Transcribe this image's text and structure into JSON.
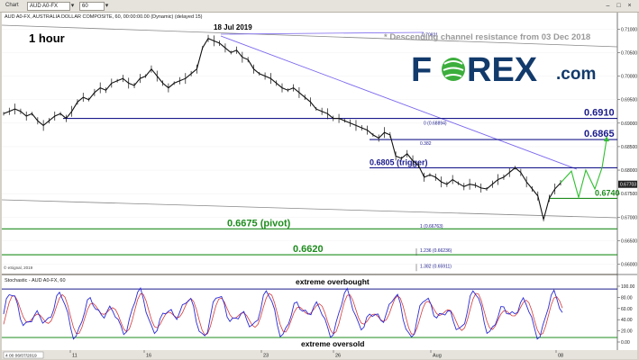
{
  "toolbar": {
    "chart_tab": "Chart",
    "symbol_field": "AUD A0-FX",
    "period_field": "60",
    "dropdown_arrow": "▾",
    "minimize_glyph": "–",
    "maximize_glyph": "□",
    "close_glyph": "×"
  },
  "chart_title": "AUD A0-FX, AUSTRALIA DOLLAR COMPOSITE, 60, 00:00:00.00 (Dynamic) (delayed 15)",
  "timeframe_label": "1 hour",
  "logo": {
    "part1": "F",
    "part2": "REX",
    "part3": ".com"
  },
  "copyright": "© eSignal, 2019",
  "chart_data": {
    "type": "line",
    "title": "AUD A0-FX, AUSTRALIA DOLLAR COMPOSITE, 60",
    "y_ticks": [
      0.71,
      0.705,
      0.7,
      0.695,
      0.69,
      0.685,
      0.68,
      0.675,
      0.67,
      0.665,
      0.66
    ],
    "y_tick_labels": [
      "0.71000",
      "0.70500",
      "0.70000",
      "0.69500",
      "0.69000",
      "0.68500",
      "0.68000",
      "0.67500",
      "0.67000",
      "0.66500",
      "0.66000"
    ],
    "ylim": [
      0.658,
      0.7135
    ],
    "current_price_label": "0.67703",
    "x_tick_labels": [
      "11",
      "16",
      "23",
      "26",
      "Aug",
      "08"
    ],
    "x_date_box": "4 00 06/07/2019",
    "price_series": [
      0.692,
      0.6925,
      0.693,
      0.6925,
      0.6915,
      0.692,
      0.6905,
      0.6895,
      0.6905,
      0.6915,
      0.692,
      0.691,
      0.6925,
      0.6945,
      0.6955,
      0.695,
      0.6965,
      0.6975,
      0.697,
      0.6985,
      0.699,
      0.6995,
      0.6985,
      0.698,
      0.6995,
      0.7,
      0.7015,
      0.7,
      0.6985,
      0.6975,
      0.6985,
      0.699,
      0.6995,
      0.7005,
      0.7015,
      0.706,
      0.708,
      0.7075,
      0.707,
      0.706,
      0.705,
      0.7055,
      0.704,
      0.7035,
      0.7015,
      0.7005,
      0.7,
      0.6995,
      0.6985,
      0.6975,
      0.697,
      0.6975,
      0.6965,
      0.6955,
      0.6945,
      0.693,
      0.6925,
      0.692,
      0.691,
      0.691,
      0.6905,
      0.69,
      0.6895,
      0.689,
      0.6885,
      0.6875,
      0.6868,
      0.688,
      0.6875,
      0.683,
      0.6825,
      0.6835,
      0.682,
      0.681,
      0.6785,
      0.679,
      0.6785,
      0.6775,
      0.677,
      0.678,
      0.6772,
      0.6765,
      0.677,
      0.6768,
      0.6762,
      0.676,
      0.677,
      0.678,
      0.6785,
      0.6795,
      0.6805,
      0.6795,
      0.6775,
      0.676,
      0.6745,
      0.6695,
      0.674,
      0.676,
      0.6773
    ],
    "projection": [
      0.6773,
      0.6798,
      0.6742,
      0.68,
      0.676,
      0.6805,
      0.6865
    ],
    "levels": [
      {
        "name": "resistance-0.6910",
        "label": "0.6910",
        "value": 0.691,
        "color": "#1a1a8c"
      },
      {
        "name": "resistance-0.6865",
        "label": "0.6865",
        "value": 0.6865,
        "color": "#1a1a8c"
      },
      {
        "name": "trigger-0.6805",
        "label": "0.6805 (trigger)",
        "value": 0.6805,
        "color": "#1a1a8c"
      },
      {
        "name": "support-0.6740",
        "label": "0.6740",
        "value": 0.674,
        "color": "#1e8c1e"
      },
      {
        "name": "pivot-0.6675",
        "label": "0.6675 (pivot)",
        "value": 0.6675,
        "color": "#1e8c1e"
      },
      {
        "name": "support-0.6620",
        "label": "0.6620",
        "value": 0.662,
        "color": "#1e8c1e"
      }
    ],
    "fib_labels": [
      {
        "name": "fib-top",
        "label": "0.70821",
        "value": 0.7082
      },
      {
        "name": "fib-0",
        "label": "0 (0.68894)",
        "value": 0.6895
      },
      {
        "name": "fib-0.382",
        "label": "0.382",
        "value": 0.6852
      },
      {
        "name": "fib-1",
        "label": "1 (0.66763)",
        "value": 0.6676
      },
      {
        "name": "fib-1.236",
        "label": "1.236 (0.66236)",
        "value": 0.6624
      },
      {
        "name": "fib-1.382",
        "label": "1.382 (0.65911)",
        "value": 0.6591
      }
    ],
    "annotations": {
      "high_date": "18 Jul 2019",
      "channel_note": "* Descending channel resistance from 03 Dec 2018"
    },
    "indicator": {
      "name": "Stochastic - AUD A0-FX, 60",
      "y_ticks": [
        100,
        80,
        60,
        40,
        20,
        0
      ],
      "y_tick_labels": [
        "100.00",
        "80.00",
        "60.00",
        "40.00",
        "20.00",
        "0.00"
      ],
      "overbought_label": "extreme overbought",
      "oversold_label": "extreme oversold"
    },
    "colors": {
      "price": "#111111",
      "channel": "#7b68ee",
      "fib": "#1a1a8c",
      "support": "#1e8c1e",
      "projection": "#2fbf2f",
      "stoch_k": "#2b2bd6",
      "stoch_d": "#d43a3a",
      "logo_blue": "#123a6b",
      "logo_green": "#3cae3c"
    }
  }
}
